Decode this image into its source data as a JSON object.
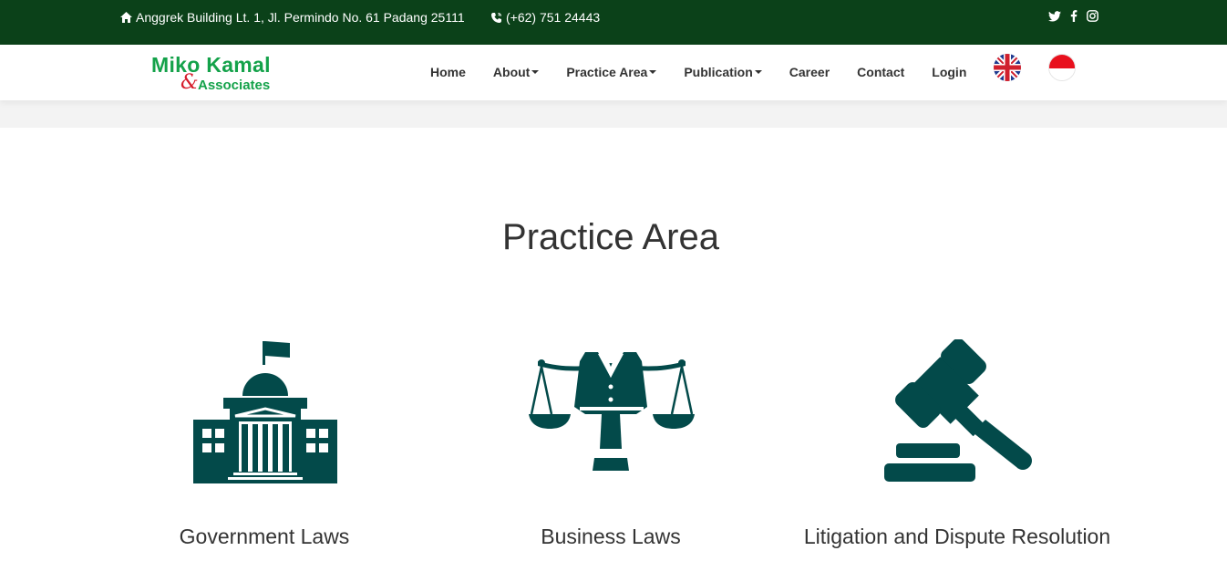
{
  "topbar": {
    "address": "Anggrek Building Lt. 1, Jl. Permindo No. 61 Padang 25111",
    "phone": "(+62) 751 24443",
    "icons": [
      "home-icon",
      "phone-icon",
      "twitter-icon",
      "facebook-icon",
      "instagram-icon"
    ]
  },
  "logo": {
    "line1": "Miko Kamal",
    "ampersand": "&",
    "line2": "Associates"
  },
  "nav": {
    "items": [
      {
        "label": "Home"
      },
      {
        "label": "About"
      },
      {
        "label": "Practice Area"
      },
      {
        "label": "Publication"
      },
      {
        "label": "Career"
      },
      {
        "label": "Contact"
      },
      {
        "label": "Login"
      }
    ],
    "languages": [
      "flag-uk-icon",
      "flag-indonesia-icon"
    ]
  },
  "section": {
    "title": "Practice Area"
  },
  "areas": [
    {
      "label": "Government Laws",
      "icon": "government-building-icon"
    },
    {
      "label": "Business Laws",
      "icon": "business-scale-icon"
    },
    {
      "label": "Litigation and Dispute Resolution",
      "icon": "gavel-icon"
    }
  ],
  "colors": {
    "topbar": "#0b4119",
    "icon": "#034a4a",
    "logo_green": "#14a24a",
    "logo_red": "#d61b2a"
  }
}
